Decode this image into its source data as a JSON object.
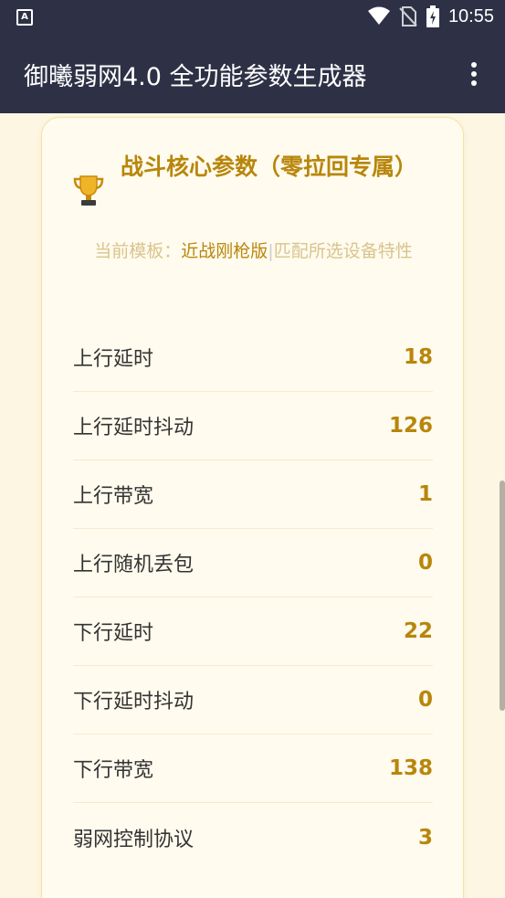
{
  "status_bar": {
    "time": "10:55",
    "icons": [
      "app-notification-icon",
      "wifi-icon",
      "no-sim-icon",
      "battery-charging-icon"
    ]
  },
  "app_bar": {
    "title": "御曦弱网4.0 全功能参数生成器"
  },
  "card": {
    "icon": "trophy-icon",
    "title": "战斗核心参数（零拉回专属）",
    "subtitle_prefix": "当前模板：",
    "template_name": "近战刚枪版",
    "separator": "|",
    "subtitle_suffix": "匹配所选设备特性",
    "params": [
      {
        "label": "上行延时",
        "value": "18"
      },
      {
        "label": "上行延时抖动",
        "value": "126"
      },
      {
        "label": "上行带宽",
        "value": "1"
      },
      {
        "label": "上行随机丢包",
        "value": "0"
      },
      {
        "label": "下行延时",
        "value": "22"
      },
      {
        "label": "下行延时抖动",
        "value": "0"
      },
      {
        "label": "下行带宽",
        "value": "138"
      },
      {
        "label": "弱网控制协议",
        "value": "3"
      }
    ]
  },
  "colors": {
    "bar_bg": "#2e3146",
    "page_bg": "#fdf6e3",
    "accent": "#b8860b",
    "muted_accent": "#d9c48d"
  }
}
